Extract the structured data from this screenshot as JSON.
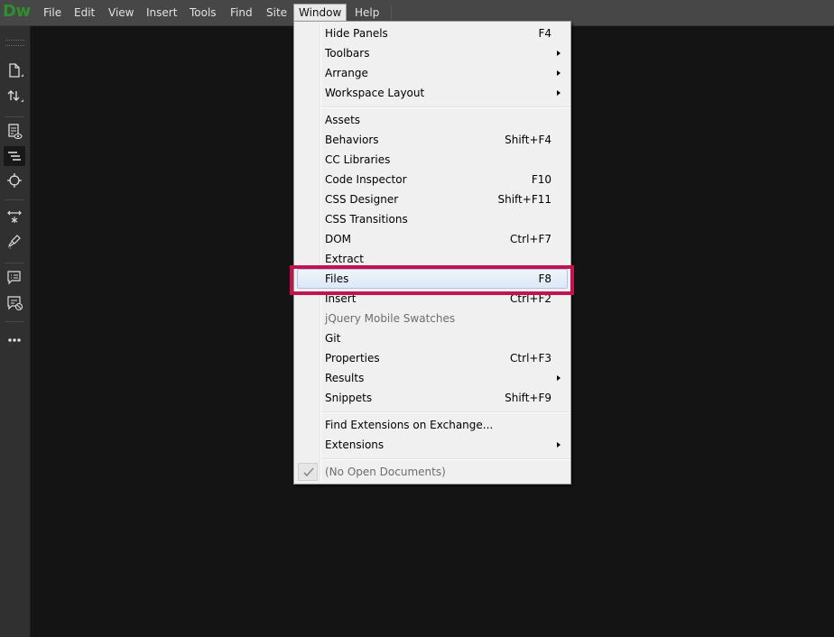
{
  "app": {
    "logo": "Dw"
  },
  "menubar": {
    "items": [
      "File",
      "Edit",
      "View",
      "Insert",
      "Tools",
      "Find",
      "Site",
      "Window",
      "Help"
    ],
    "active": "Window"
  },
  "toolbar": {
    "icons": [
      "new-document-icon",
      "file-transfer-icon",
      "live-view-icon",
      "code-outline-icon",
      "inspect-icon",
      "expand-collapse-icon",
      "brush-icon",
      "comment-icon",
      "comment-off-icon",
      "more-options-icon"
    ]
  },
  "window_menu": {
    "items": [
      {
        "label": "Hide Panels",
        "shortcut": "F4"
      },
      {
        "label": "Toolbars",
        "submenu": true
      },
      {
        "label": "Arrange",
        "submenu": true
      },
      {
        "label": "Workspace Layout",
        "submenu": true
      },
      {
        "label": "Assets"
      },
      {
        "label": "Behaviors",
        "shortcut": "Shift+F4"
      },
      {
        "label": "CC Libraries"
      },
      {
        "label": "Code Inspector",
        "shortcut": "F10"
      },
      {
        "label": "CSS Designer",
        "shortcut": "Shift+F11"
      },
      {
        "label": "CSS Transitions"
      },
      {
        "label": "DOM",
        "shortcut": "Ctrl+F7"
      },
      {
        "label": "Extract"
      },
      {
        "label": "Files",
        "shortcut": "F8",
        "highlighted": true
      },
      {
        "label": "Insert",
        "shortcut": "Ctrl+F2"
      },
      {
        "label": "jQuery Mobile Swatches",
        "disabled": true
      },
      {
        "label": "Git"
      },
      {
        "label": "Properties",
        "shortcut": "Ctrl+F3"
      },
      {
        "label": "Results",
        "submenu": true
      },
      {
        "label": "Snippets",
        "shortcut": "Shift+F9"
      },
      {
        "label": "Find Extensions on Exchange..."
      },
      {
        "label": "Extensions",
        "submenu": true
      },
      {
        "label": "(No Open Documents)",
        "disabled": true,
        "checked": true
      }
    ]
  },
  "colors": {
    "menubar_bg": "#474747",
    "toolbar_bg": "#303030",
    "workspace_bg": "#141414",
    "logo": "#2e8f2e",
    "annotation": "#c3124f",
    "menu_bg": "#f0f0f0"
  }
}
